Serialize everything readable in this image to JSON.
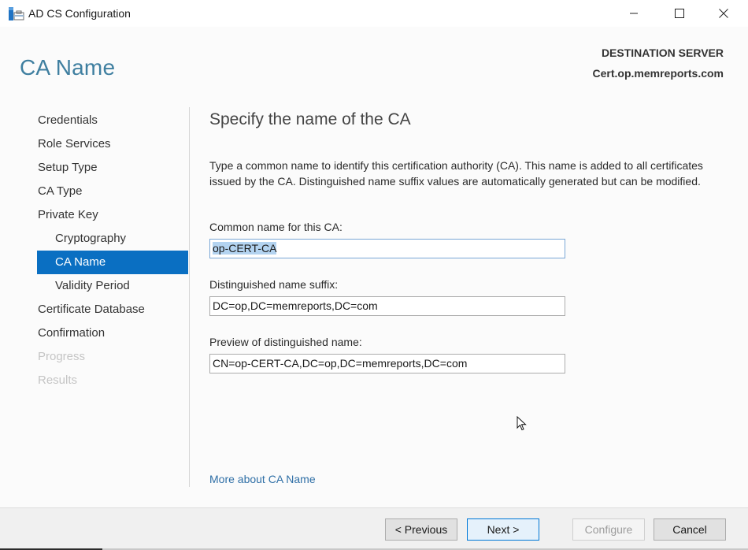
{
  "window": {
    "title": "AD CS Configuration",
    "app_icon": "server-manager-icon",
    "controls": {
      "minimize": "minimize-icon",
      "maximize": "maximize-icon",
      "close": "close-icon"
    }
  },
  "header": {
    "page_title": "CA Name",
    "destination_label": "DESTINATION SERVER",
    "destination_server": "Cert.op.memreports.com"
  },
  "nav": {
    "items": [
      {
        "label": "Credentials",
        "state": "normal",
        "level": 0
      },
      {
        "label": "Role Services",
        "state": "normal",
        "level": 0
      },
      {
        "label": "Setup Type",
        "state": "normal",
        "level": 0
      },
      {
        "label": "CA Type",
        "state": "normal",
        "level": 0
      },
      {
        "label": "Private Key",
        "state": "normal",
        "level": 0
      },
      {
        "label": "Cryptography",
        "state": "normal",
        "level": 1
      },
      {
        "label": "CA Name",
        "state": "active",
        "level": 1
      },
      {
        "label": "Validity Period",
        "state": "normal",
        "level": 1
      },
      {
        "label": "Certificate Database",
        "state": "normal",
        "level": 0
      },
      {
        "label": "Confirmation",
        "state": "normal",
        "level": 0
      },
      {
        "label": "Progress",
        "state": "disabled",
        "level": 0
      },
      {
        "label": "Results",
        "state": "disabled",
        "level": 0
      }
    ]
  },
  "main": {
    "heading": "Specify the name of the CA",
    "description": "Type a common name to identify this certification authority (CA). This name is added to all certificates issued by the CA. Distinguished name suffix values are automatically generated but can be modified.",
    "common_name": {
      "label": "Common name for this CA:",
      "value": "op-CERT-CA"
    },
    "dn_suffix": {
      "label": "Distinguished name suffix:",
      "value": "DC=op,DC=memreports,DC=com"
    },
    "dn_preview": {
      "label": "Preview of distinguished name:",
      "value": "CN=op-CERT-CA,DC=op,DC=memreports,DC=com"
    },
    "more_link": "More about CA Name"
  },
  "footer": {
    "previous": "< Previous",
    "next": "Next >",
    "configure": "Configure",
    "cancel": "Cancel"
  },
  "colors": {
    "accent": "#0a6fc2",
    "title": "#3f7fa0",
    "link": "#2f6fa6"
  }
}
